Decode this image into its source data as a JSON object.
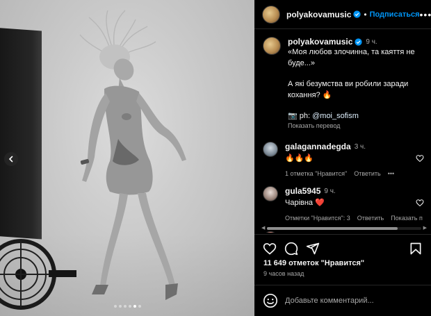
{
  "post": {
    "author": "polyakovamusic",
    "follow_label": "Подписаться",
    "more_icon": "more-horizontal-icon",
    "carousel": {
      "total": 6,
      "active": 5
    }
  },
  "caption": {
    "author": "polyakovamusic",
    "time": "9 ч.",
    "line1": "«Моя любов злочинна, та каяття не буде...»",
    "line2": "А які безумства ви робили заради кохання? 🔥",
    "credit_prefix": "📷 ph: ",
    "credit_link": "@moi_sofism",
    "translate": "Показать перевод"
  },
  "comments": [
    {
      "user": "galagannadegda",
      "time": "3 ч.",
      "text": "🔥🔥🔥",
      "likes": "1 отметка \"Нравится\"",
      "reply": "Ответить",
      "options_icon": "more-horizontal-icon"
    },
    {
      "user": "gula5945",
      "time": "9 ч.",
      "text": "Чарівна ❤️",
      "likes": "Отметки \"Нравится\": 3",
      "reply": "Ответить",
      "translate": "Показать п"
    }
  ],
  "actions": {
    "icons": [
      "heart-icon",
      "comment-icon",
      "share-icon",
      "bookmark-icon"
    ]
  },
  "likes_count": "11 649 отметок \"Нравится\"",
  "posted_ago": "9 часов назад",
  "comment_input": {
    "placeholder": "Добавьте комментарий..."
  },
  "colors": {
    "accent": "#0095f6",
    "background": "#000000",
    "heart": "#ed4956"
  }
}
